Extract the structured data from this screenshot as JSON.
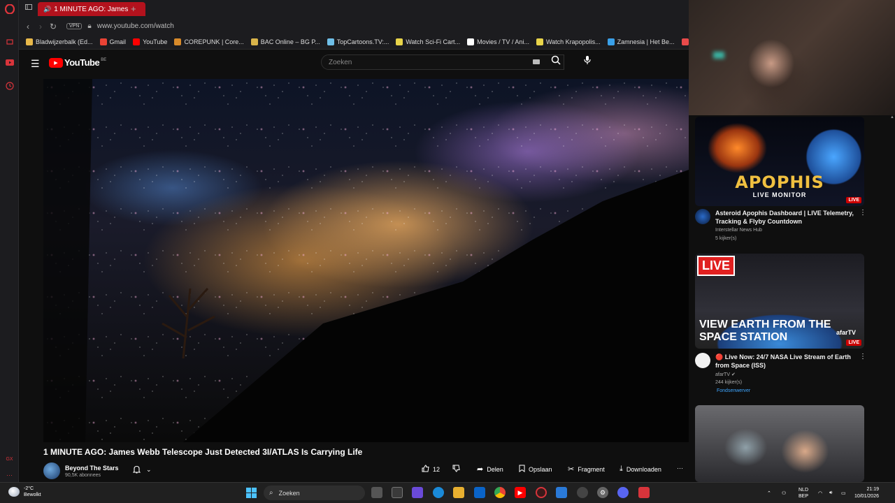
{
  "browser": {
    "tab_title": "1 MINUTE AGO: James",
    "url": "www.youtube.com/watch",
    "vpn_label": "VPN",
    "bookmarks": [
      {
        "label": "Bladwijzerbalk (Ed...",
        "icon": "folder-icon",
        "color": "#e8b84a"
      },
      {
        "label": "Gmail",
        "icon": "gmail-icon",
        "color": "#ea4335"
      },
      {
        "label": "YouTube",
        "icon": "youtube-icon",
        "color": "#ff0000"
      },
      {
        "label": "COREPUNK | Core...",
        "icon": "corepunk-icon",
        "color": "#d88a2a"
      },
      {
        "label": "BAC Online – BG P...",
        "icon": "bac-icon",
        "color": "#d9b44a"
      },
      {
        "label": "TopCartoons.TV:...",
        "icon": "topcartoons-icon",
        "color": "#6fbfe8"
      },
      {
        "label": "Watch Sci-Fi Cart...",
        "icon": "scifi-icon",
        "color": "#e8d44a"
      },
      {
        "label": "Movies / TV / Ani...",
        "icon": "play-icon",
        "color": "#ffffff"
      },
      {
        "label": "Watch Krapopolis...",
        "icon": "krapopolis-icon",
        "color": "#e8d44a"
      },
      {
        "label": "Zamnesia | Het Be...",
        "icon": "zamnesia-icon",
        "color": "#3aa0e8"
      },
      {
        "label": "EN",
        "icon": "en-icon",
        "color": "#e84a4a"
      }
    ]
  },
  "youtube": {
    "logo_text": "YouTube",
    "country": "BE",
    "search_placeholder": "Zoeken"
  },
  "video": {
    "title": "1 MINUTE AGO: James Webb Telescope Just Detected 3I/ATLAS Is Carrying Life",
    "channel": "Beyond The Stars",
    "subscribers": "90,5K abonnees",
    "likes": "12",
    "actions": {
      "share": "Delen",
      "save": "Opslaan",
      "clip": "Fragment",
      "download": "Downloaden"
    }
  },
  "recommendations": [
    {
      "thumb_title": "APOPHIS",
      "thumb_subtitle": "LIVE MONITOR",
      "badge": "LIVE",
      "title": "Asteroid Apophis Dashboard | LIVE Telemetry, Tracking & Flyby Countdown",
      "channel": "Interstellar News Hub",
      "views": "5 kijker(s)"
    },
    {
      "thumb_live": "LIVE",
      "thumb_title": "VIEW EARTH FROM THE SPACE STATION",
      "thumb_logo": "afarTV",
      "badge": "LIVE",
      "title": "🔴 Live Now: 24/7 NASA Live Stream of Earth from Space (ISS)",
      "channel": "afarTV",
      "views": "244 kijker(s)",
      "extra": "Fondsenwerver"
    }
  ],
  "taskbar": {
    "temperature": "-2°C",
    "weather": "Bewolkt",
    "search": "Zoeken",
    "lang1": "NLD",
    "lang2": "BEP",
    "time": "21:19",
    "date": "10/01/2026"
  }
}
